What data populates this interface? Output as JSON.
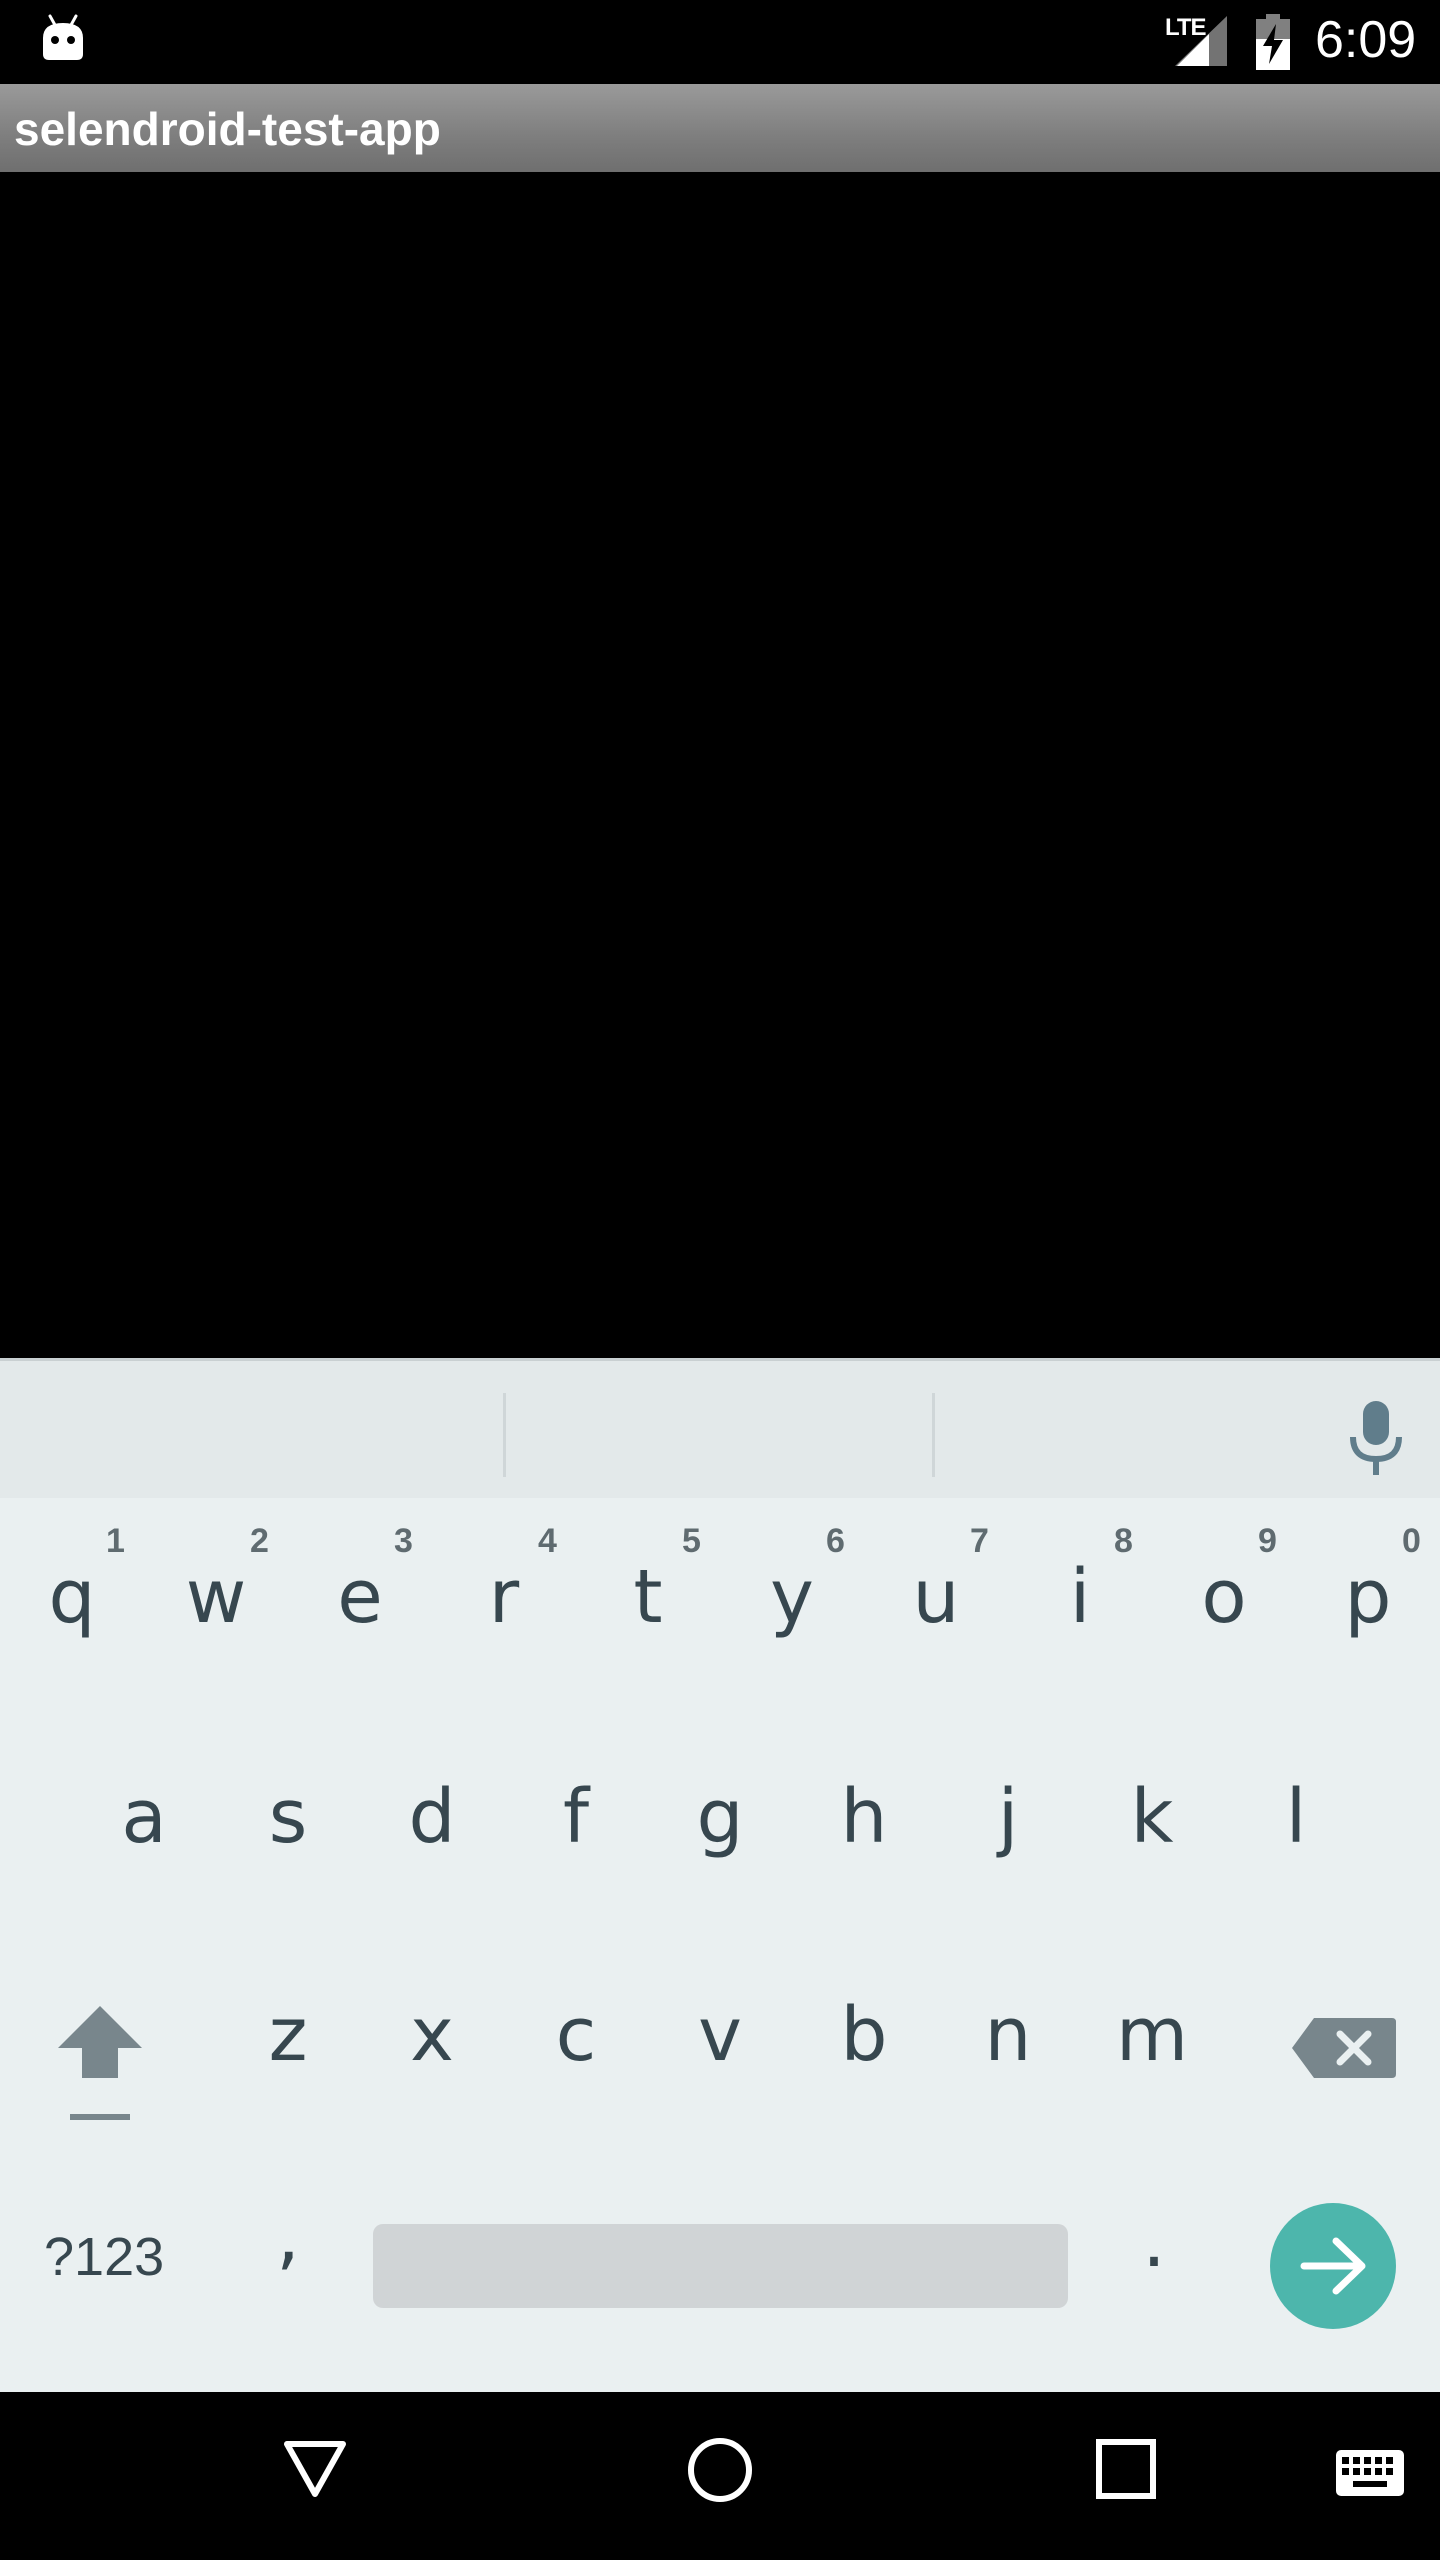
{
  "status_bar": {
    "network_label": "LTE",
    "time": "6:09",
    "notification_icon": "android-icon",
    "signal_icon": "cell-signal-icon",
    "battery_icon": "battery-charging-icon"
  },
  "app": {
    "title": "selendroid-test-app"
  },
  "keyboard": {
    "rows": [
      {
        "keys": [
          {
            "label": "q",
            "hint": "1"
          },
          {
            "label": "w",
            "hint": "2"
          },
          {
            "label": "e",
            "hint": "3"
          },
          {
            "label": "r",
            "hint": "4"
          },
          {
            "label": "t",
            "hint": "5"
          },
          {
            "label": "y",
            "hint": "6"
          },
          {
            "label": "u",
            "hint": "7"
          },
          {
            "label": "i",
            "hint": "8"
          },
          {
            "label": "o",
            "hint": "9"
          },
          {
            "label": "p",
            "hint": "0"
          }
        ]
      },
      {
        "keys": [
          {
            "label": "a"
          },
          {
            "label": "s"
          },
          {
            "label": "d"
          },
          {
            "label": "f"
          },
          {
            "label": "g"
          },
          {
            "label": "h"
          },
          {
            "label": "j"
          },
          {
            "label": "k"
          },
          {
            "label": "l"
          }
        ]
      },
      {
        "keys": [
          {
            "label": "z"
          },
          {
            "label": "x"
          },
          {
            "label": "c"
          },
          {
            "label": "v"
          },
          {
            "label": "b"
          },
          {
            "label": "n"
          },
          {
            "label": "m"
          }
        ]
      }
    ],
    "symbols_label": "?123",
    "comma_label": ",",
    "period_label": ".",
    "icons": {
      "mic": "microphone-icon",
      "shift": "shift-icon",
      "backspace": "backspace-icon",
      "enter": "arrow-right-icon"
    },
    "colors": {
      "background": "#eaf0f1",
      "key_text": "#37474f",
      "enter_accent": "#4db6ac"
    }
  },
  "nav_bar": {
    "icons": [
      "back-icon",
      "home-icon",
      "recents-icon",
      "keyboard-switch-icon"
    ]
  }
}
